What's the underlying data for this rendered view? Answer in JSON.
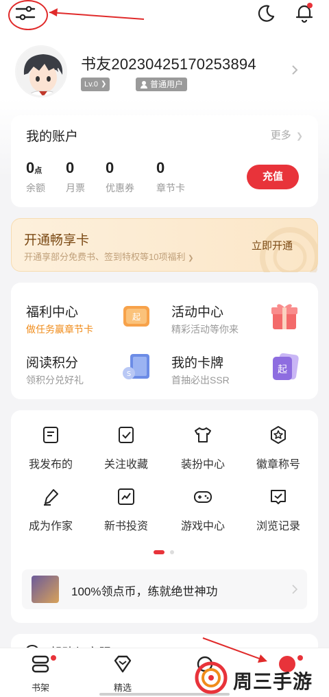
{
  "header": {
    "filter_icon": "filter-sliders-icon",
    "moon_icon": "night-mode-icon",
    "bell_icon": "notification-bell-icon"
  },
  "profile": {
    "username": "书友20230425170253894",
    "level": "Lv.0",
    "user_type": "普通用户"
  },
  "account": {
    "title": "我的账户",
    "more": "更多",
    "stats": [
      {
        "value": "0",
        "unit": "点",
        "label": "余额"
      },
      {
        "value": "0",
        "unit": "",
        "label": "月票"
      },
      {
        "value": "0",
        "unit": "",
        "label": "优惠券"
      },
      {
        "value": "0",
        "unit": "",
        "label": "章节卡"
      }
    ],
    "recharge": "充值"
  },
  "vip": {
    "title": "开通畅享卡",
    "subtitle": "开通享部分免费书、签到特权等10项福利",
    "button": "立即开通"
  },
  "features": [
    {
      "title": "福利中心",
      "subtitle": "做任务赢章节卡",
      "icon": "welfare-coupon-icon"
    },
    {
      "title": "活动中心",
      "subtitle": "精彩活动等你来",
      "icon": "gift-box-icon"
    },
    {
      "title": "阅读积分",
      "subtitle": "领积分兑好礼",
      "icon": "reading-points-icon"
    },
    {
      "title": "我的卡牌",
      "subtitle": "首抽必出SSR",
      "icon": "cards-icon"
    }
  ],
  "shortcuts": [
    {
      "label": "我发布的",
      "icon": "published-doc-icon"
    },
    {
      "label": "关注收藏",
      "icon": "bookmark-check-icon"
    },
    {
      "label": "装扮中心",
      "icon": "tshirt-icon"
    },
    {
      "label": "徽章称号",
      "icon": "badge-star-icon"
    },
    {
      "label": "成为作家",
      "icon": "pen-icon"
    },
    {
      "label": "新书投资",
      "icon": "trend-chart-icon"
    },
    {
      "label": "游戏中心",
      "icon": "gamepad-icon"
    },
    {
      "label": "浏览记录",
      "icon": "history-icon"
    }
  ],
  "promo": {
    "text": "100%领点币，练就绝世神功"
  },
  "partial_section": {
    "text": "帮助与客服"
  },
  "tabs": [
    {
      "label": "书架",
      "icon": "bookshelf-icon"
    },
    {
      "label": "精选",
      "icon": "diamond-icon"
    },
    {
      "label": "",
      "icon": "search-icon"
    },
    {
      "label": "",
      "icon": "profile-icon"
    }
  ],
  "watermark": {
    "text": "周三手游网"
  },
  "colors": {
    "accent": "#e8333a",
    "vip_text": "#7b4a15",
    "orange": "#f08c1b"
  }
}
